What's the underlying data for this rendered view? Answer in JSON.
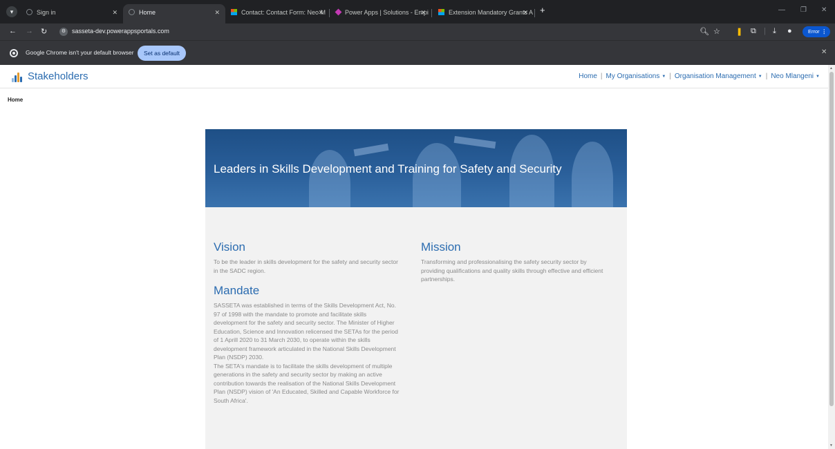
{
  "browser": {
    "tabs": [
      {
        "title": "Sign in",
        "active": false
      },
      {
        "title": "Home",
        "active": true
      },
      {
        "title": "Contact: Contact Form: Neo M",
        "active": false
      },
      {
        "title": "Power Apps | Solutions - Empi",
        "active": false
      },
      {
        "title": "Extension Mandatory Grants A",
        "active": false
      }
    ],
    "url": "sasseta-dev.powerappsportals.com",
    "profile_status": "Error"
  },
  "infobar": {
    "message": "Google Chrome isn't your default browser",
    "button_label": "Set as default"
  },
  "portal": {
    "brand": "Stakeholders",
    "nav": {
      "home": "Home",
      "my_organisations": "My Organisations",
      "organisation_management": "Organisation Management",
      "user": "Neo Mlangeni"
    },
    "breadcrumb": "Home",
    "banner_title": "Leaders in Skills Development and Training for Safety and Security",
    "vision": {
      "heading": "Vision",
      "text": "To be the leader in skills development for the safety and security sector in the SADC region."
    },
    "mission": {
      "heading": "Mission",
      "text": "Transforming and professionalising the safety security sector by providing qualifications and quality skills through effective and efficient partnerships."
    },
    "mandate": {
      "heading": "Mandate",
      "paragraph1": "SASSETA was established in terms of the Skills Development Act, No. 97 of 1998 with the mandate to promote and facilitate skills development for the safety and security sector. The Minister of Higher Education, Science and Innovation relicensed the SETAs for the period of 1 Aprill 2020 to 31 March 2030, to operate within the skills development framework articulated in the National Skills Development Plan (NSDP) 2030.",
      "paragraph2": "The SETA's mandate is to facilitate the skills development of multiple generations in the safety and security sector by making an active contribution towards the realisation of the National Skills Development Plan (NSDP) vision of 'An Educated, Skilled and Capable Workforce for South Africa'."
    }
  }
}
